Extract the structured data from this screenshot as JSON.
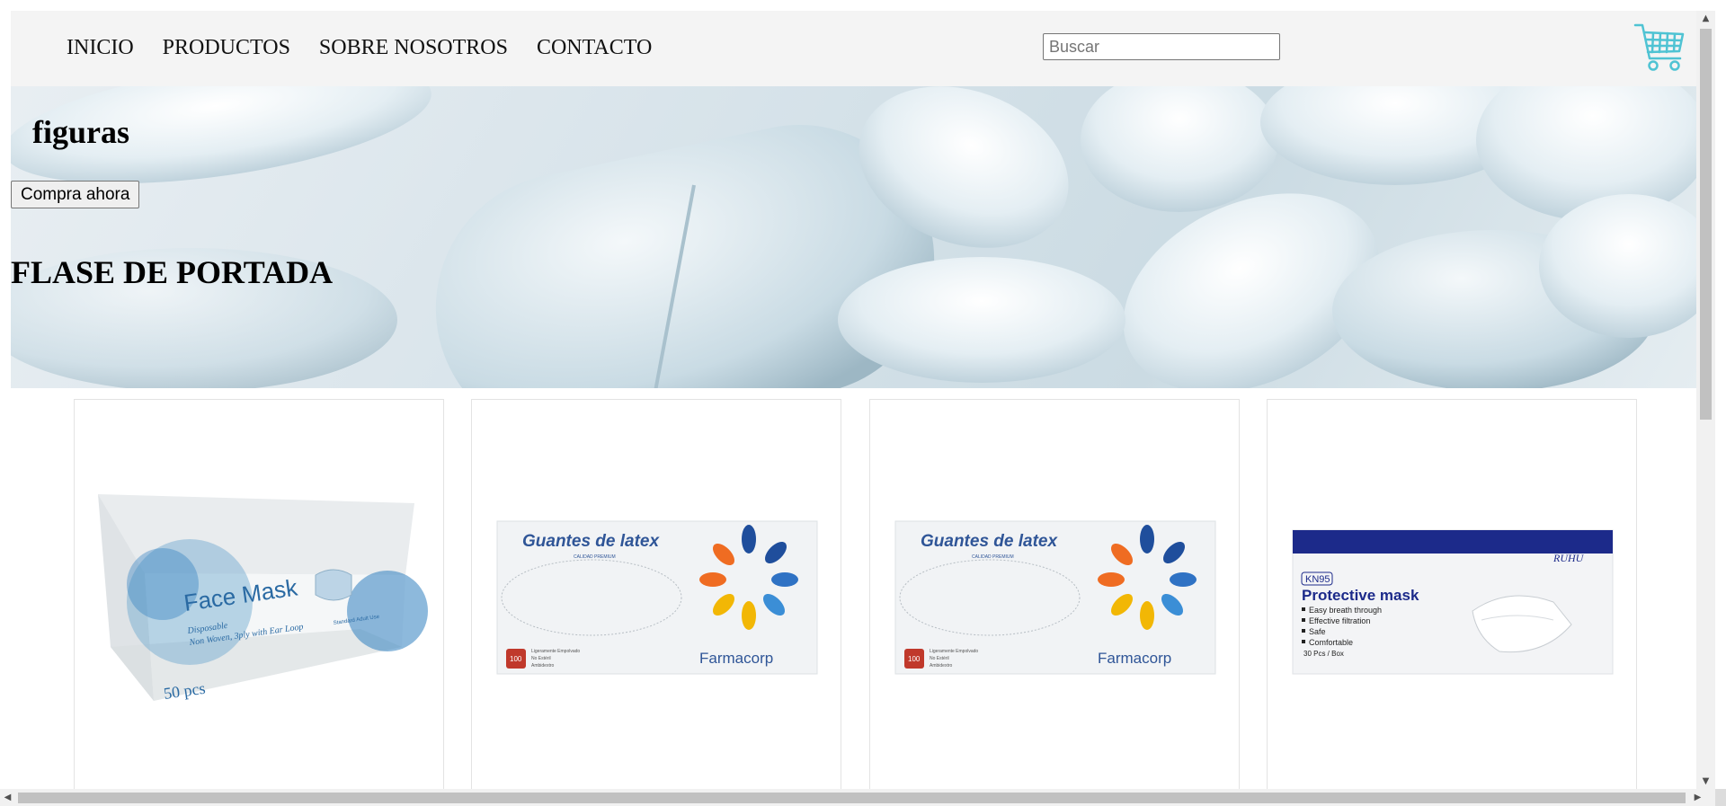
{
  "header": {
    "nav": [
      "INICIO",
      "PRODUCTOS",
      "SOBRE NOSOTROS",
      "CONTACTO"
    ],
    "search_placeholder": "Buscar",
    "cart_icon": "shopping-cart-icon",
    "accent_color": "#4fc3d3"
  },
  "hero": {
    "title": "figuras",
    "button_label": "Compra ahora",
    "heading": "FLASE DE PORTADA",
    "background": "pills-image"
  },
  "products": [
    {
      "image": "face-mask-box",
      "texts": {
        "title": "Face Mask",
        "sub1": "Disposable",
        "sub2": "Non Woven, 3ply with Ear Loop",
        "side": "Standard Adult Use",
        "count": "50 pcs"
      }
    },
    {
      "image": "latex-gloves-box",
      "texts": {
        "title": "Guantes de latex",
        "sub": "CALIDAD PREMIUM",
        "count": "100",
        "note1": "Ligeramente Empolvado",
        "note2": "No Estéril",
        "note3": "Ambidextro",
        "brand": "Farmacorp"
      }
    },
    {
      "image": "latex-gloves-box",
      "texts": {
        "title": "Guantes de latex",
        "sub": "CALIDAD PREMIUM",
        "count": "100",
        "note1": "Ligeramente Empolvado",
        "note2": "No Estéril",
        "note3": "Ambidextro",
        "brand": "Farmacorp"
      }
    },
    {
      "image": "kn95-mask-box",
      "texts": {
        "brand": "RUHU",
        "badge": "KN95",
        "title": "Protective mask",
        "b1": "Easy breath through",
        "b2": "Effective filtration",
        "b3": "Safe",
        "b4": "Comfortable",
        "count": "30 Pcs / Box"
      }
    }
  ],
  "scroll": {
    "up": "▲",
    "down": "▼",
    "left": "◀",
    "right": "▶"
  }
}
